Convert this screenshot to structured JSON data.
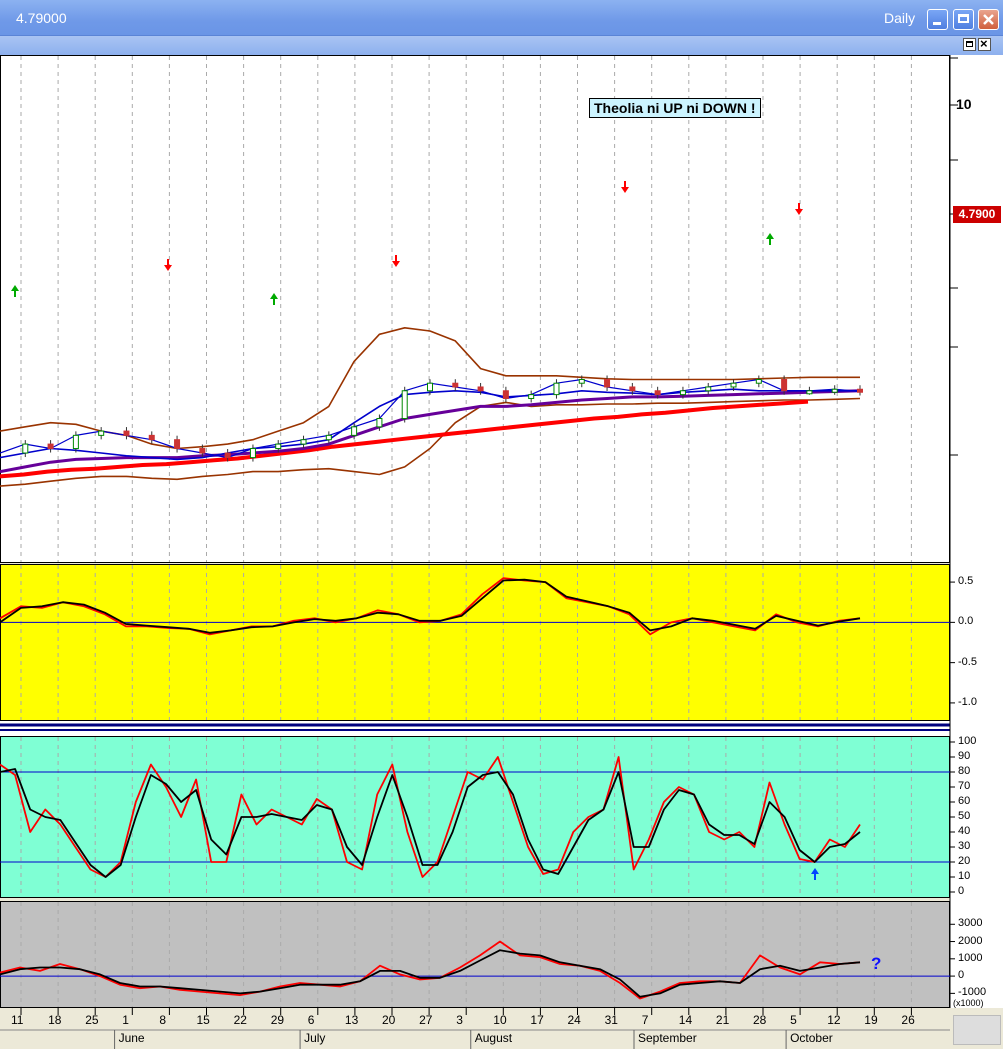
{
  "window": {
    "title": "4.79000",
    "timeframe": "Daily"
  },
  "annotation": "Theolia ni UP ni DOWN !",
  "annotation_question": "?",
  "price": {
    "last": "4.7900",
    "tick_label": "10"
  },
  "colors": {
    "panel1_bg": "#ffff00",
    "panel2_bg": "#7fffd4",
    "panel3_bg": "#c0c0c0",
    "bollinger": "#993300",
    "ma_long": "#ff0000",
    "ma_mid": "#660099",
    "ma_short": "#0000cc",
    "signal_down": "#ff0000",
    "signal_up": "#00aa00",
    "oscillator": "#000000",
    "signal_line": "#ff0000"
  },
  "x_axis": {
    "ticks": [
      "11",
      "18",
      "25",
      "1",
      "8",
      "15",
      "22",
      "29",
      "6",
      "13",
      "20",
      "27",
      "3",
      "10",
      "17",
      "24",
      "31",
      "7",
      "14",
      "21",
      "28",
      "5",
      "12",
      "19",
      "26"
    ],
    "months": [
      "June",
      "July",
      "August",
      "September",
      "October"
    ]
  },
  "chart_data": [
    {
      "type": "line",
      "panel": "price",
      "ylim": [
        3,
        12
      ],
      "scale": "log",
      "yticks": [
        "10"
      ],
      "last_value": "4.7900",
      "series": [
        {
          "values": [
            4.05,
            4.15,
            4.1,
            4.25,
            4.3,
            4.25,
            4.2,
            4.1,
            4.05,
            4.0,
            4.1,
            4.15,
            4.2,
            4.25,
            4.35,
            4.45,
            4.8,
            4.9,
            4.85,
            4.8,
            4.7,
            4.75,
            4.9,
            4.95,
            4.85,
            4.8,
            4.75,
            4.8,
            4.85,
            4.9,
            4.95,
            4.8,
            4.8,
            4.82,
            4.79
          ]
        },
        {
          "values": [
            4.0,
            4.05,
            4.1,
            4.08,
            4.05,
            4.02,
            4.0,
            3.98,
            4.0,
            4.05,
            4.1,
            4.12,
            4.15,
            4.2,
            4.4,
            4.6,
            4.75,
            4.78,
            4.8,
            4.78,
            4.72,
            4.74,
            4.76,
            4.8,
            4.78,
            4.77,
            4.75,
            4.78,
            4.8,
            4.82,
            4.8,
            4.8,
            4.8,
            4.8,
            4.8
          ]
        },
        {
          "values": [
            3.85,
            3.9,
            3.95,
            3.98,
            3.99,
            4.0,
            4.0,
            4.0,
            4.02,
            4.03,
            4.05,
            4.07,
            4.1,
            4.15,
            4.25,
            4.35,
            4.45,
            4.5,
            4.55,
            4.6,
            4.6,
            4.62,
            4.65,
            4.68,
            4.7,
            4.72,
            4.72,
            4.73,
            4.74,
            4.75,
            4.76,
            4.77,
            4.78,
            4.79,
            4.8
          ]
        },
        {
          "values": [
            3.8,
            3.82,
            3.85,
            3.87,
            3.88,
            3.9,
            3.92,
            3.93,
            3.95,
            3.97,
            3.99,
            4.02,
            4.05,
            4.08,
            4.12,
            4.15,
            4.18,
            4.21,
            4.24,
            4.27,
            4.3,
            4.33,
            4.36,
            4.39,
            4.42,
            4.45,
            4.47,
            4.5,
            4.52,
            4.55,
            4.58,
            4.6,
            4.62,
            4.64,
            4.66
          ]
        },
        {
          "values": [
            4.3,
            4.35,
            4.4,
            4.38,
            4.3,
            4.25,
            4.15,
            4.1,
            4.12,
            4.15,
            4.2,
            4.3,
            4.4,
            4.6,
            5.2,
            5.6,
            5.7,
            5.65,
            5.5,
            5.1,
            5.0,
            5.0,
            5.0,
            4.98,
            4.96,
            4.95,
            4.95,
            4.95,
            4.95,
            4.95,
            4.96,
            4.97,
            4.98,
            4.98,
            4.98
          ]
        },
        {
          "values": [
            3.7,
            3.72,
            3.75,
            3.78,
            3.8,
            3.8,
            3.78,
            3.77,
            3.8,
            3.82,
            3.85,
            3.85,
            3.87,
            3.88,
            3.85,
            3.82,
            3.9,
            4.1,
            4.4,
            4.6,
            4.65,
            4.6,
            4.62,
            4.62,
            4.63,
            4.63,
            4.64,
            4.64,
            4.65,
            4.66,
            4.67,
            4.68,
            4.68,
            4.69,
            4.7
          ]
        }
      ]
    },
    {
      "type": "line",
      "panel": "oscillator-1",
      "ylim": [
        -1.15,
        0.65
      ],
      "yticks": [
        "0.5",
        "0.0",
        "-0.5",
        "-1.0"
      ],
      "zero_line": 0.0,
      "series": [
        {
          "values": [
            0.05,
            0.2,
            0.18,
            0.25,
            0.2,
            0.1,
            -0.05,
            -0.05,
            -0.07,
            -0.08,
            -0.15,
            -0.1,
            -0.05,
            -0.05,
            0.02,
            0.05,
            0.0,
            0.05,
            0.15,
            0.1,
            0.0,
            0.02,
            0.1,
            0.35,
            0.55,
            0.52,
            0.5,
            0.3,
            0.25,
            0.2,
            0.1,
            -0.15,
            0.0,
            0.05,
            0.0,
            -0.05,
            -0.1,
            0.1,
            0.0,
            -0.05,
            0.02,
            0.05
          ]
        },
        {
          "values": [
            0.0,
            0.18,
            0.2,
            0.25,
            0.22,
            0.12,
            -0.02,
            -0.04,
            -0.06,
            -0.08,
            -0.13,
            -0.1,
            -0.06,
            -0.05,
            0.0,
            0.04,
            0.02,
            0.05,
            0.12,
            0.1,
            0.02,
            0.02,
            0.08,
            0.3,
            0.52,
            0.53,
            0.5,
            0.32,
            0.26,
            0.2,
            0.12,
            -0.1,
            -0.05,
            0.05,
            0.02,
            -0.03,
            -0.08,
            0.08,
            0.02,
            -0.04,
            0.01,
            0.05
          ]
        }
      ]
    },
    {
      "type": "line",
      "panel": "stochastic",
      "ylim": [
        0,
        100
      ],
      "yticks": [
        "100",
        "90",
        "80",
        "70",
        "60",
        "50",
        "40",
        "30",
        "20",
        "10",
        "0"
      ],
      "levels": [
        80,
        20
      ],
      "series": [
        {
          "values": [
            85,
            78,
            40,
            55,
            45,
            30,
            15,
            10,
            20,
            60,
            85,
            70,
            50,
            75,
            20,
            20,
            65,
            45,
            55,
            50,
            45,
            62,
            55,
            20,
            15,
            65,
            85,
            40,
            10,
            20,
            50,
            80,
            75,
            90,
            60,
            30,
            12,
            15,
            40,
            50,
            55,
            90,
            15,
            35,
            60,
            70,
            65,
            40,
            35,
            40,
            30,
            73,
            45,
            22,
            20,
            35,
            30,
            45
          ]
        },
        {
          "values": [
            80,
            82,
            55,
            50,
            48,
            33,
            18,
            10,
            18,
            50,
            78,
            72,
            60,
            68,
            35,
            25,
            50,
            50,
            52,
            50,
            48,
            58,
            55,
            30,
            18,
            50,
            78,
            50,
            18,
            18,
            40,
            70,
            78,
            80,
            65,
            35,
            15,
            12,
            30,
            48,
            55,
            80,
            30,
            30,
            55,
            68,
            65,
            45,
            38,
            38,
            32,
            60,
            50,
            28,
            20,
            30,
            32,
            40
          ]
        }
      ]
    },
    {
      "type": "line",
      "panel": "volume-oscillator",
      "ylim": [
        -1500,
        4000
      ],
      "yticks": [
        "3000",
        "2000",
        "1000",
        "0",
        "-1000"
      ],
      "unit_label": "(x1000)",
      "zero_line": 0,
      "series": [
        {
          "values": [
            200,
            500,
            300,
            700,
            400,
            0,
            -500,
            -700,
            -600,
            -800,
            -900,
            -1000,
            -1100,
            -900,
            -600,
            -400,
            -500,
            -600,
            -300,
            600,
            100,
            -200,
            -100,
            500,
            1200,
            2000,
            1200,
            1100,
            700,
            600,
            300,
            -400,
            -1300,
            -900,
            -400,
            -300,
            -300,
            -400,
            1200,
            500,
            100,
            800,
            700,
            800
          ]
        },
        {
          "values": [
            100,
            400,
            500,
            500,
            400,
            100,
            -400,
            -600,
            -600,
            -700,
            -800,
            -900,
            -1000,
            -900,
            -700,
            -500,
            -500,
            -500,
            -300,
            300,
            300,
            -100,
            -100,
            300,
            900,
            1500,
            1300,
            1200,
            800,
            600,
            400,
            -200,
            -1200,
            -1000,
            -500,
            -400,
            -300,
            -400,
            400,
            600,
            300,
            500,
            700,
            800
          ]
        }
      ]
    }
  ]
}
